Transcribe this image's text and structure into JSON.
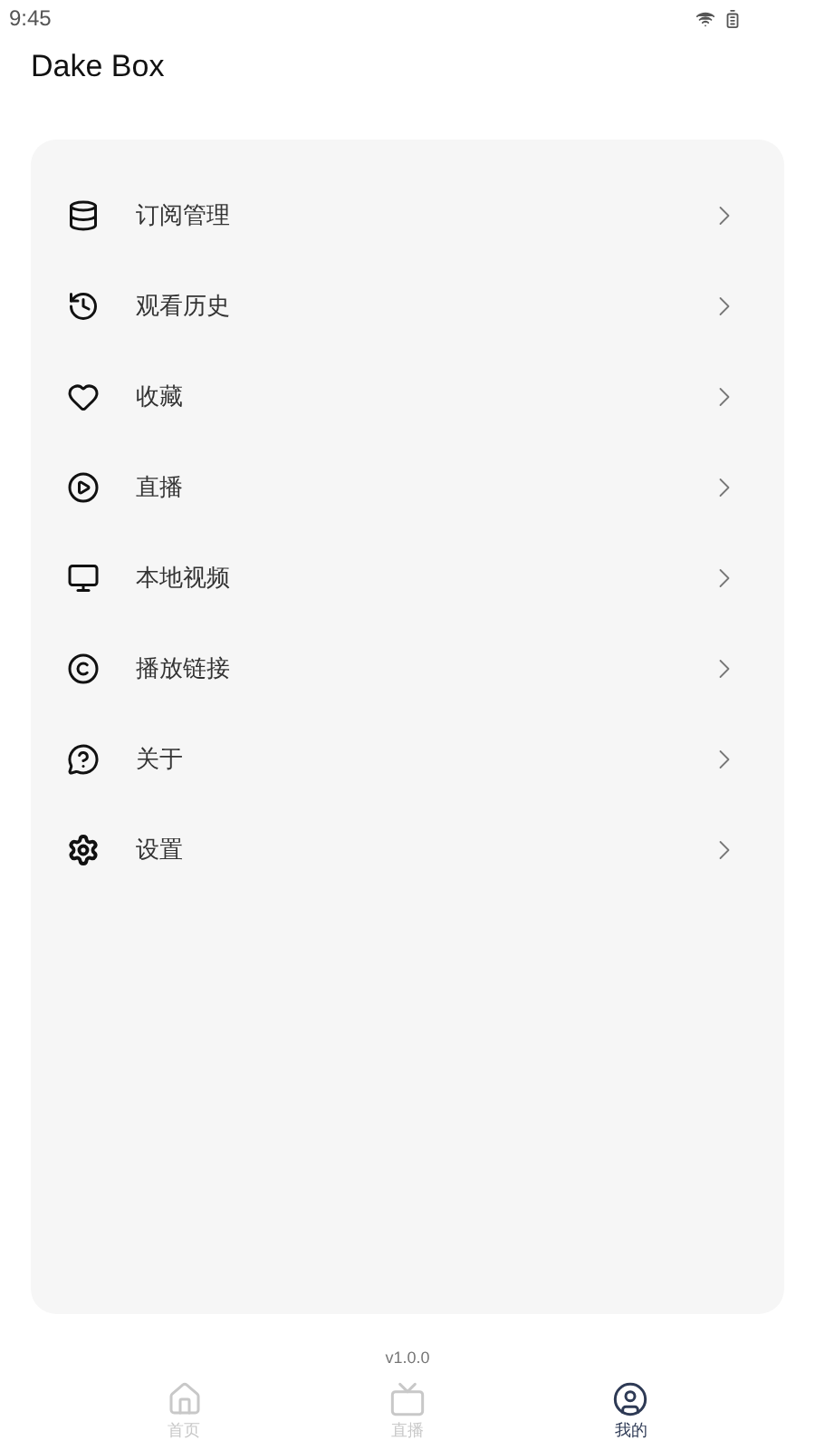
{
  "status_bar": {
    "time": "9:45"
  },
  "app_bar": {
    "title": "Dake Box"
  },
  "menu": [
    {
      "label": "订阅管理"
    },
    {
      "label": "观看历史"
    },
    {
      "label": "收藏"
    },
    {
      "label": "直播"
    },
    {
      "label": "本地视频"
    },
    {
      "label": "播放链接"
    },
    {
      "label": "关于"
    },
    {
      "label": "设置"
    }
  ],
  "version": "v1.0.0",
  "bottom_nav": [
    {
      "label": "首页",
      "selected": false
    },
    {
      "label": "直播",
      "selected": false
    },
    {
      "label": "我的",
      "selected": true
    }
  ]
}
